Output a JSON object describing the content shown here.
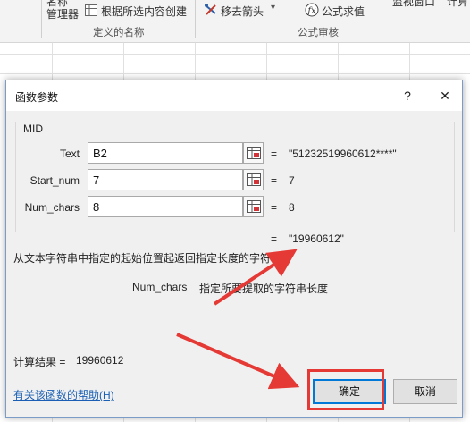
{
  "ribbon": {
    "name_manager_top": "名称",
    "name_manager_bottom": "管理器",
    "create_from_selection": "根据所选内容创建",
    "defined_names_group": "定义的名称",
    "remove_arrows": "移去箭头",
    "evaluate_formula": "公式求值",
    "formula_auditing_group": "公式审核",
    "watch_window": "监视窗口",
    "calc": "计算"
  },
  "dialog": {
    "title": "函数参数",
    "help_glyph": "?",
    "close_glyph": "✕",
    "function_name": "MID",
    "args": [
      {
        "label": "Text",
        "value": "B2",
        "result": "\"51232519960612****\""
      },
      {
        "label": "Start_num",
        "value": "7",
        "result": "7"
      },
      {
        "label": "Num_chars",
        "value": "8",
        "result": "8"
      }
    ],
    "equals": "=",
    "formula_result_preview": "\"19960612\"",
    "description": "从文本字符串中指定的起始位置起返回指定长度的字符",
    "arg_help_name": "Num_chars",
    "arg_help_text": "指定所要提取的字符串长度",
    "calc_result_label": "计算结果 =",
    "calc_result_value": "19960612",
    "help_link": "有关该函数的帮助(H)",
    "ok_label": "确定",
    "cancel_label": "取消"
  },
  "colors": {
    "annotation_red": "#e53935",
    "dialog_border": "#7a9cc6",
    "link_blue": "#1a5fb4"
  }
}
